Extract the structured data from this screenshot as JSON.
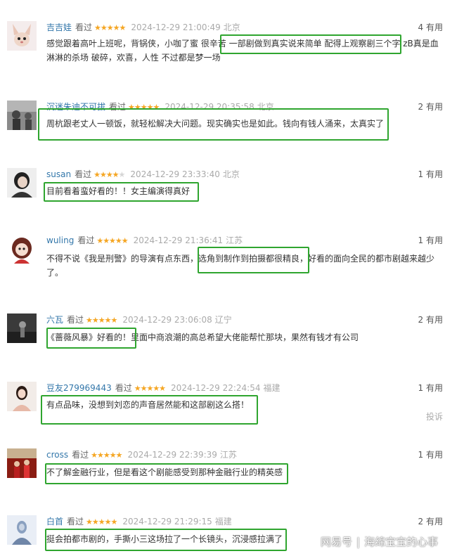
{
  "comments": [
    {
      "user": "吉吉娃",
      "status": "看过",
      "rating": 5,
      "time": "2024-12-29 21:00:49",
      "location": "北京",
      "useful": "4 有用",
      "text": "感觉跟着高叶上班呢，背锅侠，小咖了蜜 很辛苦 一部剧做到真实说来简单 配得上观察剧三个字 zB真是血淋淋的杀场 破碎，欢喜，人性 不过都是梦一场"
    },
    {
      "user": "沉迷朱迪不可拔",
      "status": "看过",
      "rating": 5,
      "time": "2024-12-29 20:35:58",
      "location": "北京",
      "useful": "2 有用",
      "text": "周杭跟老丈人一顿饭，就轻松解决大问题。现实确实也是如此。钱向有钱人涌来，太真实了"
    },
    {
      "user": "susan",
      "status": "看过",
      "rating": 4,
      "time": "2024-12-29 23:33:40",
      "location": "北京",
      "useful": "1 有用",
      "text": "目前看着蛮好看的！！女主编演得真好"
    },
    {
      "user": "wuling",
      "status": "看过",
      "rating": 5,
      "time": "2024-12-29 21:36:41",
      "location": "江苏",
      "useful": "1 有用",
      "text": "不得不说《我是刑警》的导演有点东西，选角到制作到拍摄都很精良，好看的面向全民的都市剧越来越少了。"
    },
    {
      "user": "六瓦",
      "status": "看过",
      "rating": 5,
      "time": "2024-12-29 23:06:08",
      "location": "辽宁",
      "useful": "2 有用",
      "text": "《蔷薇风暴》好看的！里面中商浪潮的高总希望大佬能帮忙那块，果然有钱才有公司"
    },
    {
      "user": "豆友279969443",
      "status": "看过",
      "rating": 5,
      "time": "2024-12-29 22:24:54",
      "location": "福建",
      "useful": "1 有用",
      "text": "有点品味，没想到刘恋的声音居然能和这部剧这么搭！"
    },
    {
      "user": "cross",
      "status": "看过",
      "rating": 5,
      "time": "2024-12-29 22:39:39",
      "location": "江苏",
      "useful": "1 有用",
      "text": "不了解金融行业，但是看这个剧能感受到那种金融行业的精英感"
    },
    {
      "user": "白首",
      "status": "看过",
      "rating": 5,
      "time": "2024-12-29 21:29:15",
      "location": "福建",
      "useful": "2 有用",
      "text": "挺会拍都市剧的，手撕小三这场拉了一个长镜头，沉浸感拉满了"
    }
  ],
  "report_label": "投诉",
  "watermark": {
    "left": "网易号",
    "right": "海绵宝宝的心事"
  },
  "colors": {
    "username": "#3377aa",
    "star": "#f5a623",
    "highlight": "#2fa52f",
    "muted": "#aaaaaa"
  }
}
